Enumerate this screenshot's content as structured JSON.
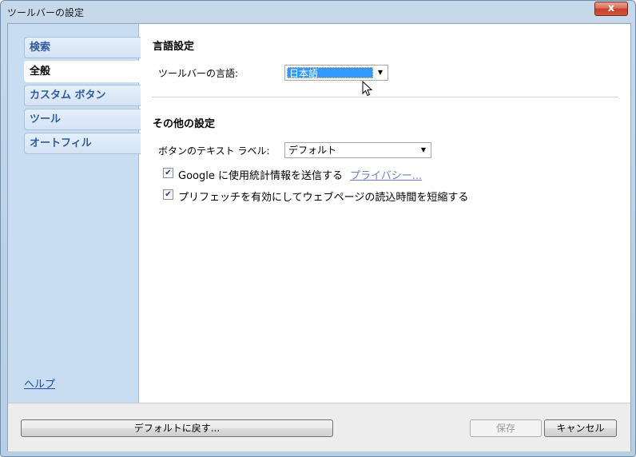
{
  "window": {
    "title": "ツールバーの設定",
    "close_label": "x"
  },
  "sidebar": {
    "items": [
      {
        "label": "検索"
      },
      {
        "label": "全般"
      },
      {
        "label": "カスタム ボタン"
      },
      {
        "label": "ツール"
      },
      {
        "label": "オートフィル"
      }
    ],
    "selected_index": 1,
    "help_label": "ヘルプ"
  },
  "language_section": {
    "heading": "言語設定",
    "language_label": "ツールバーの言語:",
    "language_value": "日本語"
  },
  "other_section": {
    "heading": "その他の設定",
    "button_text_label": "ボタンのテキスト ラベル:",
    "button_text_value": "デフォルト",
    "stats_checkbox_label": "Google に使用統計情報を送信する",
    "stats_checked": true,
    "privacy_link": "プライバシー...",
    "prefetch_checkbox_label": "プリフェッチを有効にしてウェブページの読込時間を短縮する",
    "prefetch_checked": true
  },
  "footer": {
    "reset_label": "デフォルトに戻す...",
    "save_label": "保存",
    "cancel_label": "キャンセル"
  },
  "icons": {
    "check": "check-icon",
    "dropdown": "chevron-down-icon",
    "cursor": "mouse-pointer-icon"
  }
}
